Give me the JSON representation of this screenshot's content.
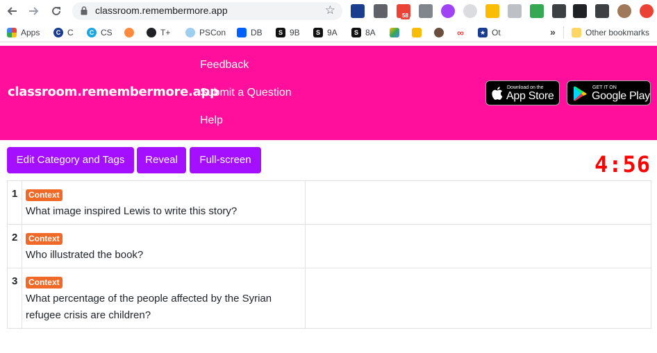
{
  "browser": {
    "url": "classroom.remembermore.app",
    "back_icon": "arrow-left-icon",
    "forward_icon": "arrow-right-icon",
    "reload_icon": "reload-icon",
    "mail_badge": "58",
    "bookmarks": [
      {
        "label": "Apps",
        "icon": "apps-grid-icon",
        "color": "#4285f4"
      },
      {
        "label": "C",
        "icon": "c-icon",
        "color": "#1a3d8f"
      },
      {
        "label": "CS",
        "icon": "cs-icon",
        "color": "#1ba8e0"
      },
      {
        "label": "",
        "icon": "rocket-icon",
        "color": "#ff8a3d"
      },
      {
        "label": "T+",
        "icon": "globe-icon",
        "color": "#202124"
      },
      {
        "label": "PSCon",
        "icon": "pscon-icon",
        "color": "#9ecff0"
      },
      {
        "label": "DB",
        "icon": "dropbox-icon",
        "color": "#0061ff"
      },
      {
        "label": "9B",
        "icon": "s-icon",
        "color": "#111111"
      },
      {
        "label": "9A",
        "icon": "s-icon",
        "color": "#111111"
      },
      {
        "label": "8A",
        "icon": "s-icon",
        "color": "#111111"
      },
      {
        "label": "",
        "icon": "drive-icon",
        "color": "#1fa463"
      },
      {
        "label": "",
        "icon": "keep-icon",
        "color": "#fbbc04"
      },
      {
        "label": "",
        "icon": "person-icon",
        "color": "#6b4e3d"
      },
      {
        "label": "",
        "icon": "infinity-icon",
        "color": "#e8453c"
      },
      {
        "label": "Ot",
        "icon": "star-shield-icon",
        "color": "#1a3d8f"
      }
    ],
    "more_bookmarks": "»",
    "other_bookmarks": "Other bookmarks"
  },
  "header": {
    "brand": "classroom.remembermore.app",
    "nav": [
      "Feedback",
      "Submit a Question",
      "Help"
    ],
    "app_store": {
      "small": "Download on the",
      "big": "App Store"
    },
    "google_play": {
      "small": "GET IT ON",
      "big": "Google Play"
    }
  },
  "controls": {
    "edit_label": "Edit Category and Tags",
    "reveal_label": "Reveal",
    "fullscreen_label": "Full-screen",
    "timer": "4:56"
  },
  "questions": [
    {
      "number": "1",
      "tag": "Context",
      "text": "What image inspired Lewis to write this story?"
    },
    {
      "number": "2",
      "tag": "Context",
      "text": "Who illustrated the book?"
    },
    {
      "number": "3",
      "tag": "Context",
      "text": "What percentage of the people affected by the Syrian refugee crisis are children?"
    }
  ],
  "colors": {
    "header_bg": "#ff0f9b",
    "button_bg": "#a40fff",
    "tag_bg": "#f06926",
    "timer": "#ff0000"
  }
}
